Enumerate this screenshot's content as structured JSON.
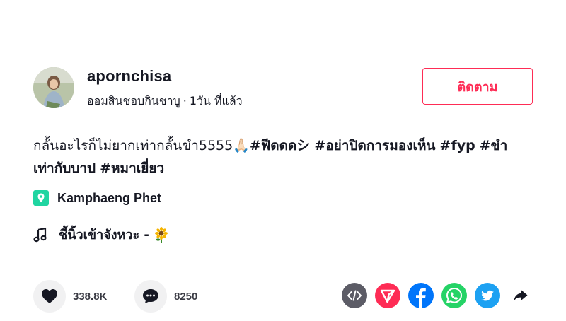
{
  "author": {
    "username": "apornchisa",
    "display_name": "ออมสินชอบกินชาบู",
    "separator": "·",
    "time_ago": "1วัน ที่แล้ว"
  },
  "follow_label": "ติดตาม",
  "caption": {
    "text": "กลั้นอะไรก็ไม่ยากเท่ากลั้นขำ5555🙏🏻",
    "hashtags": [
      "#ฟีดดดシ",
      "#อย่าปิดการมองเห็น",
      "#fyp",
      "#ขำเท่ากับบาป",
      "#หมาเยี่ยว"
    ]
  },
  "location": "Kamphaeng Phet",
  "music": "ชี้นิ้วเข้าจังหวะ - ",
  "stats": {
    "likes": "338.8K",
    "comments": "8250"
  },
  "icons": {
    "like": "heart-icon",
    "comment": "comment-icon",
    "embed": "embed-code-icon",
    "send": "send-to-friends-icon",
    "facebook": "facebook-icon",
    "whatsapp": "whatsapp-icon",
    "twitter": "twitter-icon",
    "more_share": "share-arrow-icon",
    "location": "location-pin-icon",
    "music": "music-note-icon"
  },
  "colors": {
    "accent": "#fe2c55",
    "embed": "#5c5c66",
    "facebook": "#0075fa",
    "whatsapp": "#25d366",
    "twitter": "#1da1f2",
    "location": "#20d5a1"
  }
}
